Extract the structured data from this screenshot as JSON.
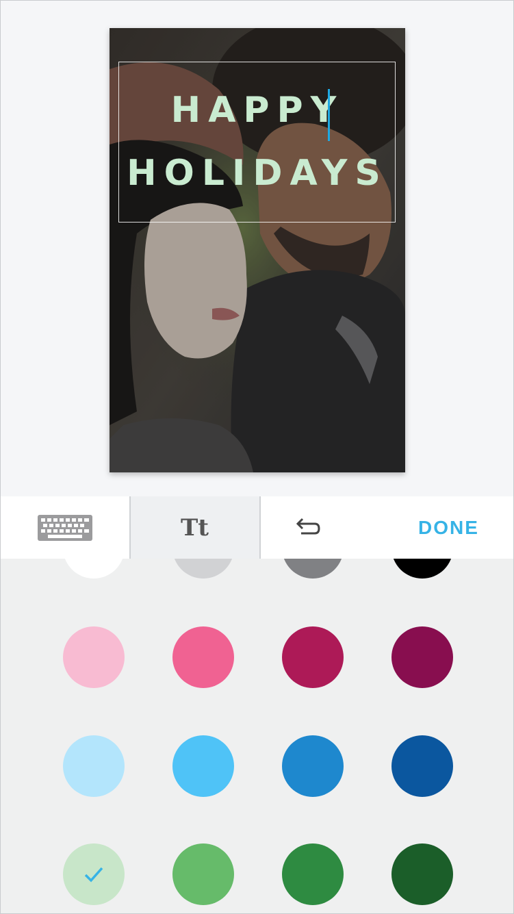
{
  "card": {
    "line1": "HAPPY",
    "line2": "HOLIDAYS",
    "text_color": "#c9ebd0",
    "caret_color": "#1ea8e2"
  },
  "toolbar": {
    "keyboard_icon": "keyboard-icon",
    "text_style_label": "Tt",
    "undo_icon": "undo-icon",
    "done_label": "DONE",
    "accent": "#36b3e6"
  },
  "palette": {
    "selected": "#c8e6c9",
    "rows": [
      [
        "#ffffff",
        "#d1d2d4",
        "#808184",
        "#000000"
      ],
      [
        "#f8bbd2",
        "#f06292",
        "#ad1a57",
        "#880e4f"
      ],
      [
        "#b3e5fc",
        "#4fc3f7",
        "#1e88ce",
        "#0b579f"
      ],
      [
        "#c8e6c9",
        "#66bb6a",
        "#2e8b41",
        "#1b5e29"
      ]
    ]
  }
}
